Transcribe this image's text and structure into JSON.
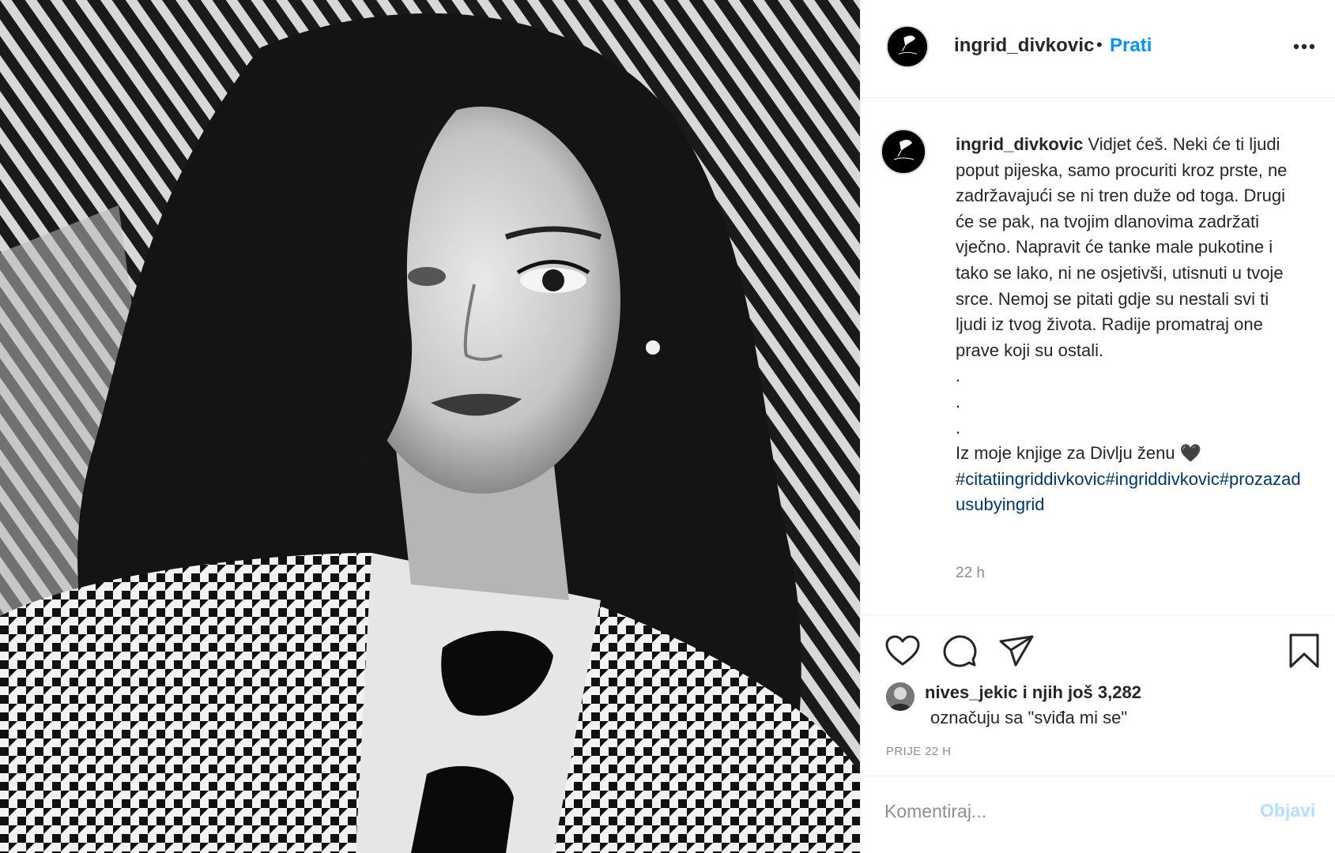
{
  "post": {
    "username": "ingrid_divkovic",
    "separator": "•",
    "follow_label": "Prati",
    "caption_text": "Vidjet ćeš. Neki će ti ljudi poput pijeska, samo procuriti kroz prste, ne zadržavajući se ni tren duže od toga. Drugi će se pak, na tvojim dlanovima zadržati vječno. Napravit će tanke male pukotine i tako se lako, ni ne osjetivši, utisnuti u tvoje srce. Nemoj se pitati gdje su nestali svi ti ljudi iz tvog života. Radije promatraj one prave koji su ostali.",
    "dots": [
      ".",
      ".",
      "."
    ],
    "book_line": "Iz moje knjige za Divlju ženu 🖤",
    "hashtags": "#citatiingriddivkovic#ingriddivkovic#prozazadusubyingrid",
    "caption_time": "22 h",
    "likes_user": "nives_jekic",
    "likes_more": "i njih još 3,282",
    "likes_line2": "označuju sa \"sviđa mi se\"",
    "post_time": "PRIJE 22 H",
    "comment_placeholder": "Komentiraj...",
    "post_button": "Objavi"
  },
  "icons": {
    "more": "more-horizontal-icon",
    "like": "heart-icon",
    "comment": "comment-bubble-icon",
    "share": "paper-plane-icon",
    "save": "bookmark-icon"
  },
  "colors": {
    "accent": "#0095f6",
    "hashtag": "#00376b",
    "muted": "#8e8e8e",
    "post_button_disabled": "#b2dffc"
  }
}
